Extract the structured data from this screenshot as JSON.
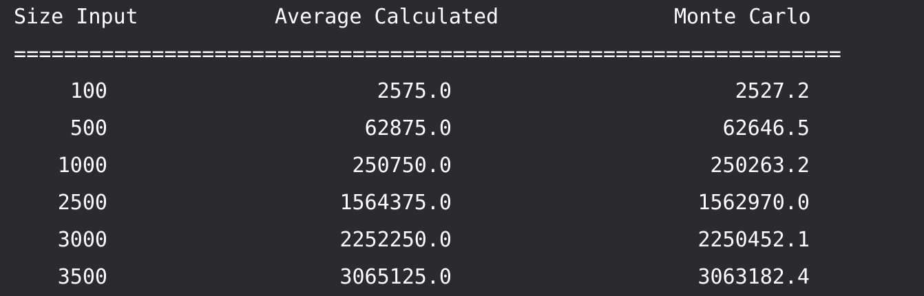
{
  "header": {
    "size_input": "Size Input",
    "average_calculated": "Average Calculated",
    "monte_carlo": "Monte Carlo"
  },
  "separator": "==================================================================",
  "rows": [
    {
      "size": "100",
      "average": "2575.0",
      "monte_carlo": "2527.2"
    },
    {
      "size": "500",
      "average": "62875.0",
      "monte_carlo": "62646.5"
    },
    {
      "size": "1000",
      "average": "250750.0",
      "monte_carlo": "250263.2"
    },
    {
      "size": "2500",
      "average": "1564375.0",
      "monte_carlo": "1562970.0"
    },
    {
      "size": "3000",
      "average": "2252250.0",
      "monte_carlo": "2250452.1"
    },
    {
      "size": "3500",
      "average": "3065125.0",
      "monte_carlo": "3063182.4"
    }
  ]
}
